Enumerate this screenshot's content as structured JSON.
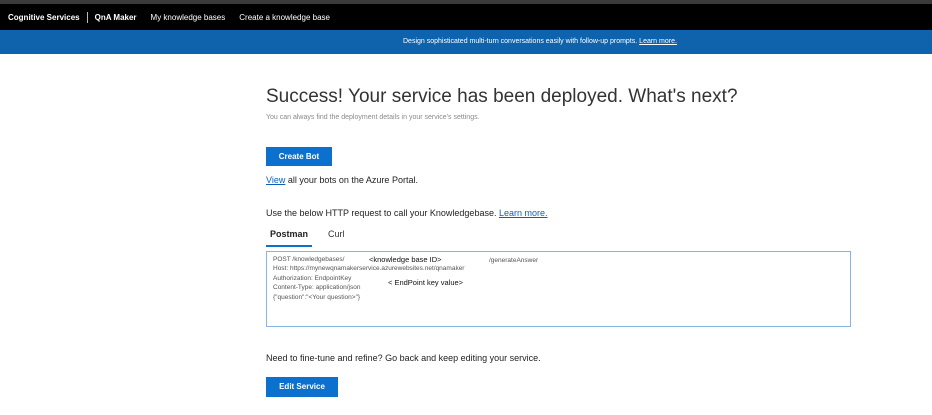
{
  "topbar": {
    "brand": "Cognitive Services",
    "product": "QnA Maker",
    "nav": [
      "My knowledge bases",
      "Create a knowledge base"
    ]
  },
  "banner": {
    "text": "Design sophisticated multi-turn conversations easily with follow-up prompts.",
    "link": "Learn more."
  },
  "main": {
    "title": "Success! Your service has been deployed. What's next?",
    "subtitle": "You can always find the deployment details in your service's settings.",
    "create_bot_label": "Create Bot",
    "view_link": "View",
    "view_rest": "all your bots on the Azure Portal.",
    "http_text": "Use the below HTTP request to call your Knowledgebase.",
    "http_link": "Learn more.",
    "tabs": [
      "Postman",
      "Curl"
    ],
    "code": {
      "lines": [
        "POST /knowledgebases/",
        "Host: https://mynewqnamakerservice.azurewebsites.net/qnamaker",
        "Authorization: EndpointKey",
        "Content-Type: application/json",
        "{\"question\":\"<Your question>\"}"
      ],
      "generate_answer": "/generateAnswer",
      "kb_id_placeholder": "<knowledge base ID>",
      "endpoint_key_placeholder": "< EndPoint key value>"
    },
    "finetune_text": "Need to fine-tune and refine? Go back and keep editing your service.",
    "edit_service_label": "Edit Service"
  },
  "colors": {
    "banner": "#0f63ad",
    "button": "#0c70cf",
    "link": "#0c5fbf",
    "topbar": "#000000"
  }
}
